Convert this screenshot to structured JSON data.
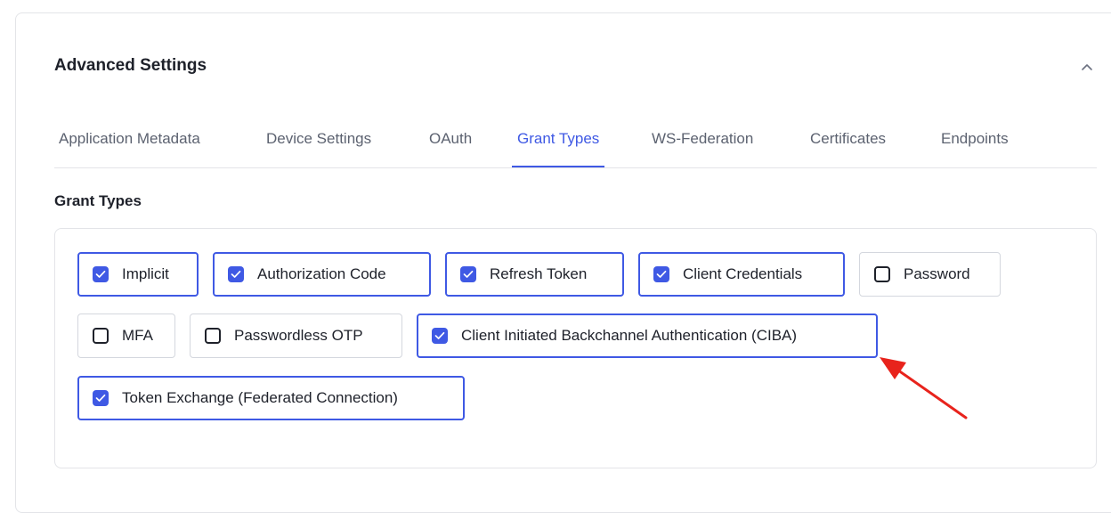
{
  "section": {
    "title": "Advanced Settings"
  },
  "tabs": [
    {
      "label": "Application Metadata",
      "active": false
    },
    {
      "label": "Device Settings",
      "active": false
    },
    {
      "label": "OAuth",
      "active": false
    },
    {
      "label": "Grant Types",
      "active": true
    },
    {
      "label": "WS-Federation",
      "active": false
    },
    {
      "label": "Certificates",
      "active": false
    },
    {
      "label": "Endpoints",
      "active": false
    }
  ],
  "grant_types": {
    "title": "Grant Types",
    "options": [
      {
        "label": "Implicit",
        "checked": true
      },
      {
        "label": "Authorization Code",
        "checked": true
      },
      {
        "label": "Refresh Token",
        "checked": true
      },
      {
        "label": "Client Credentials",
        "checked": true
      },
      {
        "label": "Password",
        "checked": false
      },
      {
        "label": "MFA",
        "checked": false
      },
      {
        "label": "Passwordless OTP",
        "checked": false
      },
      {
        "label": "Client Initiated Backchannel Authentication (CIBA)",
        "checked": true
      },
      {
        "label": "Token Exchange (Federated Connection)",
        "checked": true
      }
    ]
  },
  "colors": {
    "accent": "#3f59e4",
    "annotation_arrow": "#e8231c"
  },
  "icons": {
    "collapse": "chevron-up-icon",
    "checked": "checkmark-icon",
    "annotation": "red-arrow-annotation"
  }
}
